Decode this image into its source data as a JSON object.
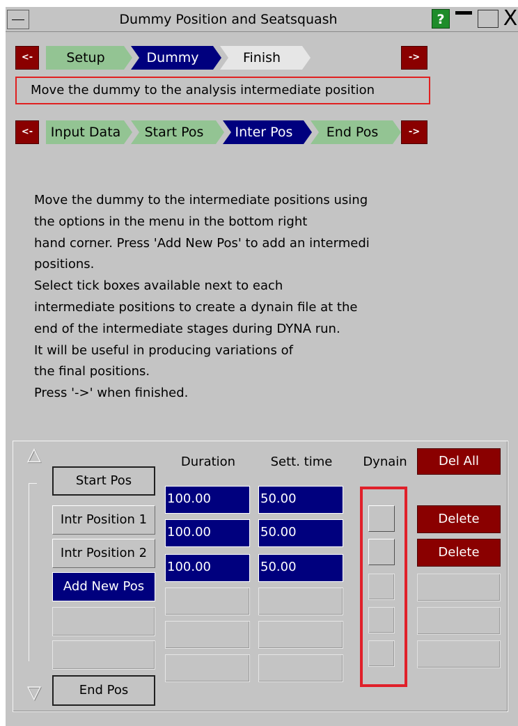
{
  "window": {
    "title": "Dummy Position and Seatsquash",
    "help_label": "?",
    "close_label": "X"
  },
  "top_nav": {
    "back_label": "<-",
    "next_label": "->",
    "steps": [
      {
        "label": "Setup",
        "state": "done"
      },
      {
        "label": "Dummy",
        "state": "active"
      },
      {
        "label": "Finish",
        "state": "todo"
      }
    ]
  },
  "info_text": "Move the dummy to the analysis intermediate position",
  "sub_nav": {
    "back_label": "<-",
    "next_label": "->",
    "steps": [
      {
        "label": "Input Data",
        "state": "done"
      },
      {
        "label": "Start Pos",
        "state": "done"
      },
      {
        "label": "Inter Pos",
        "state": "active"
      },
      {
        "label": "End Pos",
        "state": "done"
      }
    ]
  },
  "instructions": [
    "Move the dummy to the intermediate positions using",
    "the options in the menu in the bottom right",
    "hand corner. Press 'Add New Pos' to add an intermedi",
    "positions.",
    "Select tick boxes available next to each",
    "intermediate positions to create a dynain file at the",
    "end of the intermediate stages during DYNA run.",
    "It will be useful in producing variations of",
    "the final positions.",
    "Press '->' when finished."
  ],
  "table": {
    "headers": {
      "duration": "Duration",
      "settle": "Sett. time",
      "dynain": "Dynain"
    },
    "del_all_label": "Del All",
    "start_label": "Start Pos",
    "end_label": "End Pos",
    "rows": [
      {
        "position": "Intr Position 1",
        "duration": "100.00",
        "settle": "50.00",
        "delete": "Delete"
      },
      {
        "position": "Intr Position 2",
        "duration": "100.00",
        "settle": "50.00",
        "delete": "Delete"
      },
      {
        "position": "Add New Pos",
        "duration": "100.00",
        "settle": "50.00",
        "delete": ""
      },
      {
        "position": "",
        "duration": "",
        "settle": "",
        "delete": ""
      },
      {
        "position": "",
        "duration": "",
        "settle": "",
        "delete": ""
      },
      {
        "position": "",
        "duration": "",
        "settle": "",
        "delete": ""
      }
    ]
  },
  "colors": {
    "panel_bg": "#c4c4c4",
    "active_blue": "#00007e",
    "done_green": "#93c493",
    "nav_red": "#8a0000",
    "highlight_red": "#e0202a"
  }
}
